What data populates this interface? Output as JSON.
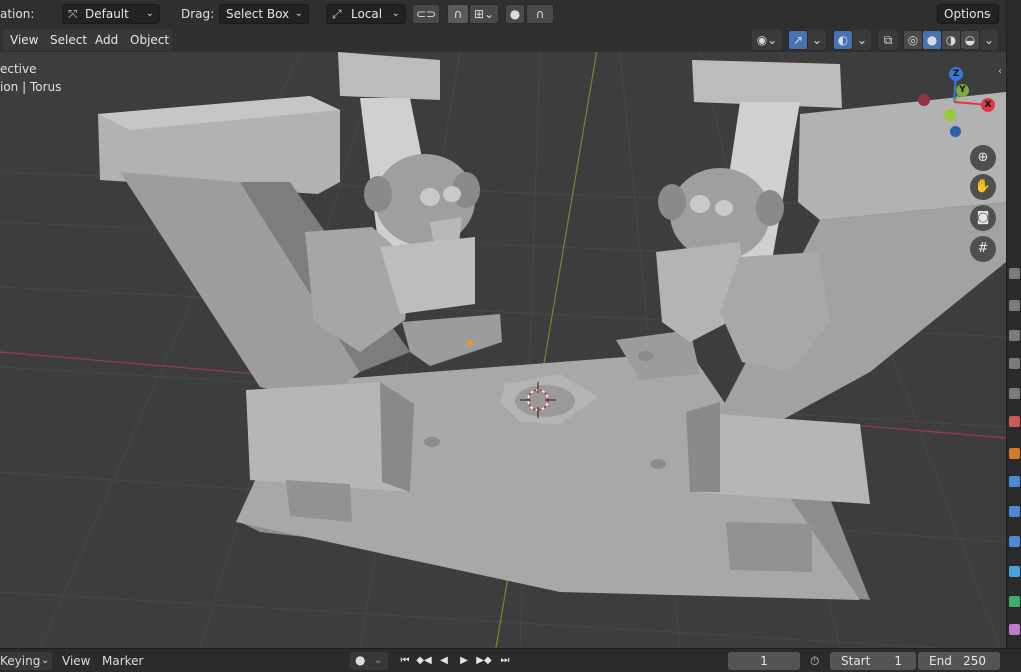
{
  "topbar": {
    "orientation_label": "ation:",
    "orientation_value": "Default",
    "drag_label": "Drag:",
    "drag_value": "Select Box",
    "pivot_value": "Local",
    "options_label": "Options"
  },
  "menus": [
    "View",
    "Select",
    "Add",
    "Object"
  ],
  "overlay": {
    "view_name": "ective",
    "collection": "ion | Torus"
  },
  "gizmo": {
    "z": "Z",
    "y": "Y",
    "x": "X"
  },
  "timeline": {
    "keying": "Keying",
    "view": "View",
    "marker": "Marker",
    "current_frame": "1",
    "start_label": "Start",
    "start_value": "1",
    "end_label": "End",
    "end_value": "250"
  },
  "icons": {
    "orientation": "transform-orientation-icon",
    "pivot": "pivot-point-icon",
    "snap": "magnet-icon",
    "proportional": "proportional-edit-icon",
    "zoom": "zoom-icon",
    "pan": "hand-icon",
    "camera": "camera-icon",
    "grid": "grid-icon"
  },
  "colors": {
    "x_axis": "#d93a4a",
    "y_axis": "#7ea83a",
    "z_axis": "#3a77d9",
    "viewport_bg": "#3d3d3d",
    "accent": "#4772b3"
  }
}
